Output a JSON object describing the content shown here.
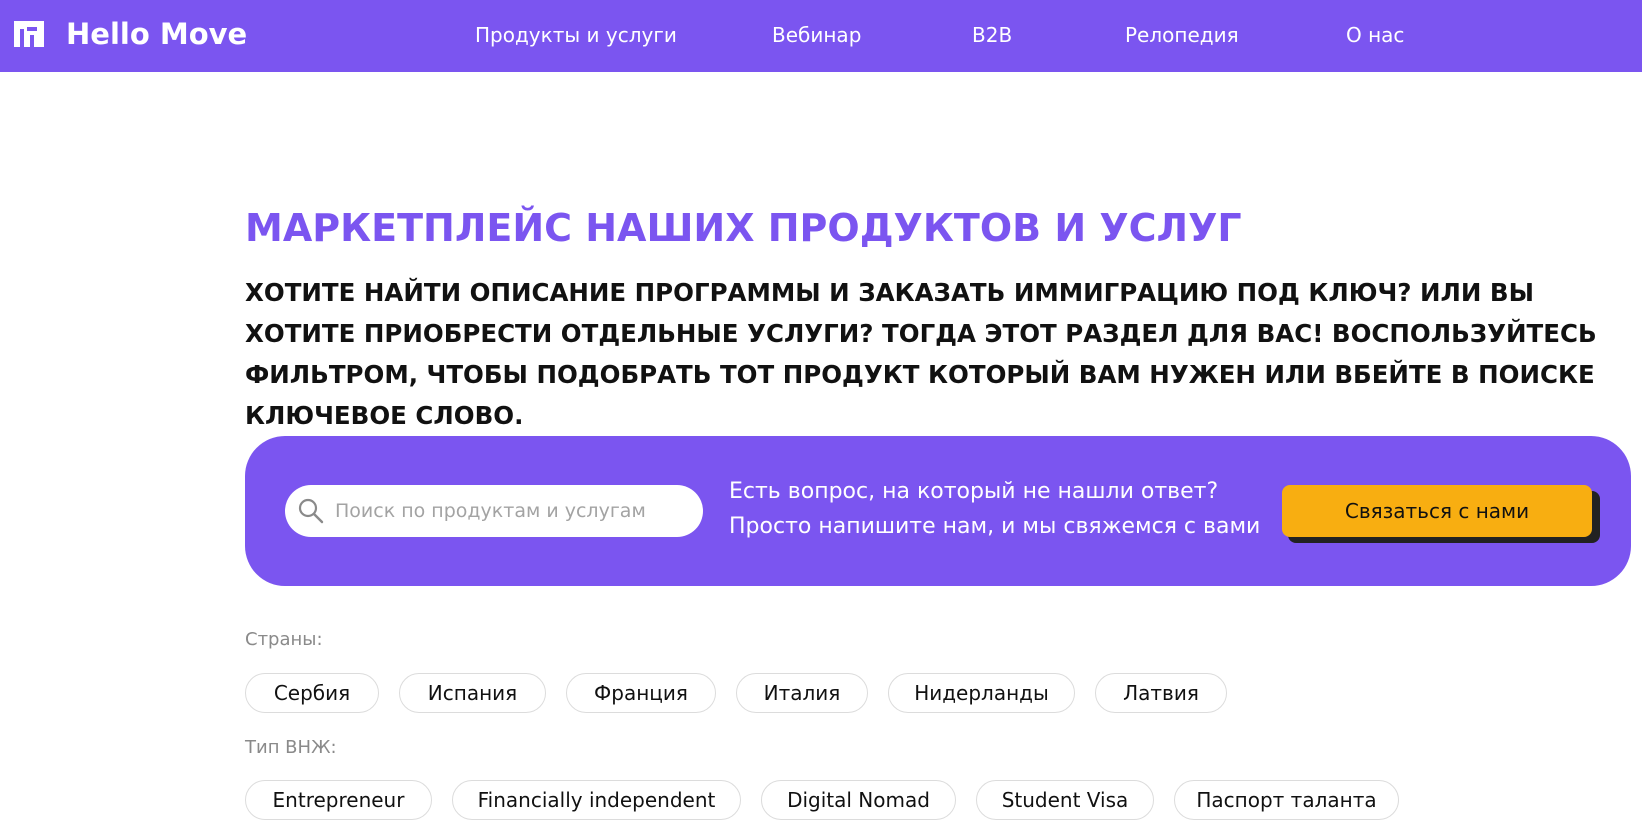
{
  "header": {
    "brand": "Hello Move",
    "nav": [
      "Продукты и услуги",
      "Вебинар",
      "B2B",
      "Релопедия",
      "О нас"
    ]
  },
  "main": {
    "title": "МАРКЕТПЛЕЙС НАШИХ ПРОДУКТОВ И УСЛУГ",
    "intro": "ХОТИТЕ НАЙТИ ОПИСАНИЕ ПРОГРАММЫ И ЗАКАЗАТЬ ИММИГРАЦИЮ ПОД КЛЮЧ? ИЛИ ВЫ ХОТИТЕ ПРИОБРЕСТИ ОТДЕЛЬНЫЕ УСЛУГИ? ТОГДА ЭТОТ РАЗДЕЛ ДЛЯ ВАС! ВОСПОЛЬЗУЙТЕСЬ ФИЛЬТРОМ, ЧТОБЫ ПОДОБРАТЬ ТОТ ПРОДУКТ КОТОРЫЙ ВАМ НУЖЕН ИЛИ ВБЕЙТЕ В ПОИСКЕ КЛЮЧЕВОЕ СЛОВО."
  },
  "banner": {
    "search_placeholder": "Поиск по продуктам и услугам",
    "search_value": "",
    "question_line1": "Есть вопрос, на который не нашли ответ?",
    "question_line2": "Просто напишите нам, и мы свяжемся с вами",
    "contact_label": "Связаться с нами"
  },
  "filters": {
    "countries_label": "Страны:",
    "countries": [
      "Сербия",
      "Испания",
      "Франция",
      "Италия",
      "Нидерланды",
      "Латвия"
    ],
    "permit_label": "Тип ВНЖ:",
    "permits": [
      "Entrepreneur",
      "Financially independent",
      "Digital Nomad",
      "Student Visa",
      "Паспорт таланта"
    ]
  },
  "colors": {
    "brand": "#7b55f0",
    "accent_button": "#f8ae11",
    "chip_border": "#dcdcdc"
  },
  "icons": {
    "logo": "hello-move-logo-icon",
    "search": "search-icon"
  }
}
